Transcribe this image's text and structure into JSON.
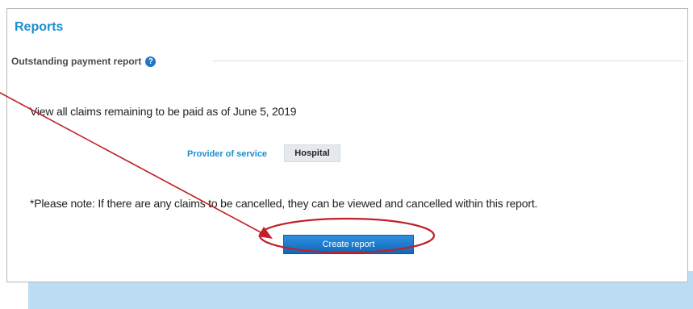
{
  "reports": {
    "title": "Reports"
  },
  "section": {
    "title": "Outstanding payment report",
    "help_icon": "?"
  },
  "intro": {
    "text": "View all claims remaining to be paid as of June 5, 2019"
  },
  "provider": {
    "label": "Provider of service",
    "value": "Hospital"
  },
  "note": {
    "text": "*Please note: If there are any claims to be cancelled, they can be viewed and cancelled within this report."
  },
  "actions": {
    "create_report": "Create report"
  },
  "colors": {
    "accent": "#1a8fcf",
    "button": "#1f74c4",
    "annotation": "#c0202a",
    "strip": "#bcdcf3"
  },
  "icons": {
    "help": "help-icon"
  }
}
